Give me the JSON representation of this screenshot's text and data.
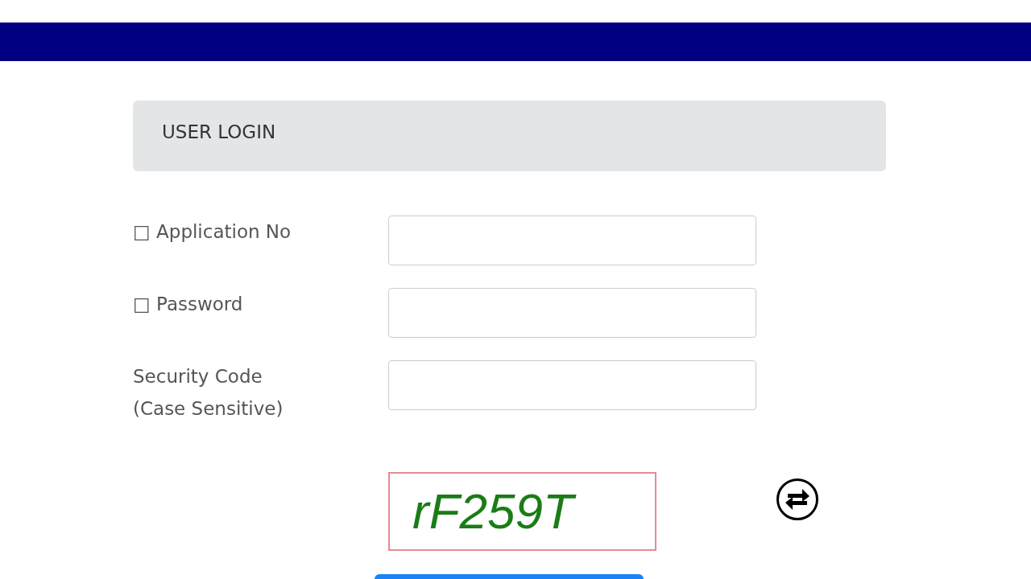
{
  "panel": {
    "title": "USER LOGIN"
  },
  "fields": [
    {
      "label": "□ Application No"
    },
    {
      "label": "□ Password"
    },
    {
      "label": "Security Code\n(Case Sensitive)"
    }
  ],
  "captcha": {
    "code": "rF259T"
  }
}
